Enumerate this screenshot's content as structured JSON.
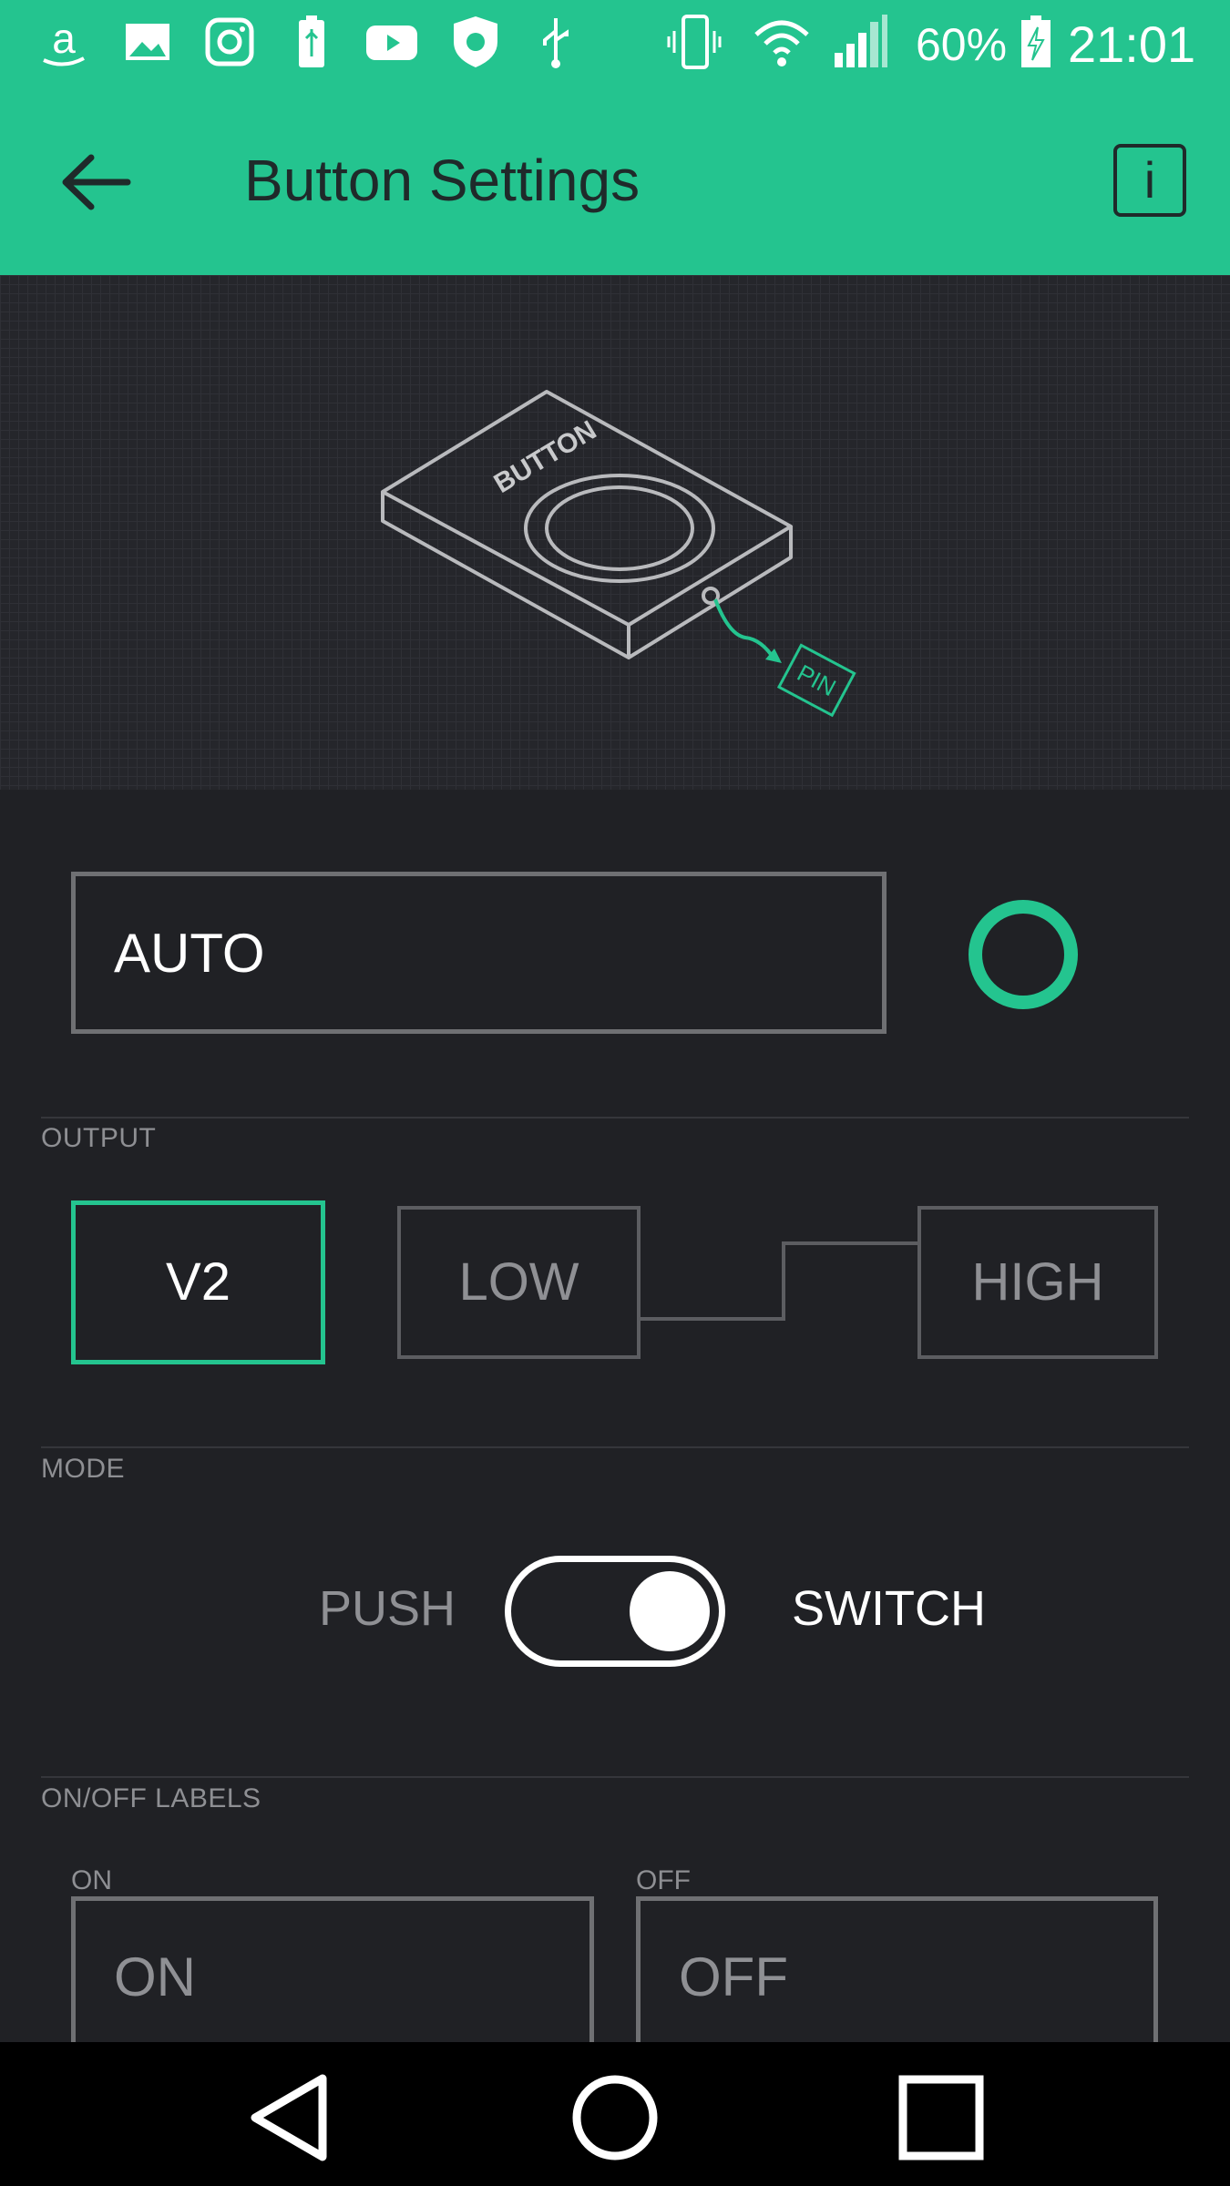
{
  "status_bar": {
    "battery_percent": "60%",
    "time": "21:01",
    "icons": [
      "amazon-icon",
      "gallery-icon",
      "instagram-icon",
      "battery-usb-icon",
      "youtube-icon",
      "shield-icon",
      "usb-icon",
      "vibrate-icon",
      "wifi-icon",
      "signal-icon",
      "battery-charging-icon"
    ]
  },
  "app_bar": {
    "title": "Button Settings",
    "info_label": "i"
  },
  "illustration": {
    "device_label": "BUTTON",
    "pin_label": "PIN"
  },
  "widget": {
    "name_value": "AUTO",
    "accent_color": "#24c48f"
  },
  "output": {
    "section_label": "OUTPUT",
    "pin_value": "V2",
    "low_value": "LOW",
    "high_value": "HIGH"
  },
  "mode": {
    "section_label": "MODE",
    "left_option": "PUSH",
    "right_option": "SWITCH",
    "selected": "SWITCH"
  },
  "labels": {
    "section_label": "ON/OFF LABELS",
    "on_caption": "ON",
    "off_caption": "OFF",
    "on_placeholder": "ON",
    "off_placeholder": "OFF"
  },
  "colors": {
    "header": "#24c48f",
    "background": "#202125"
  }
}
